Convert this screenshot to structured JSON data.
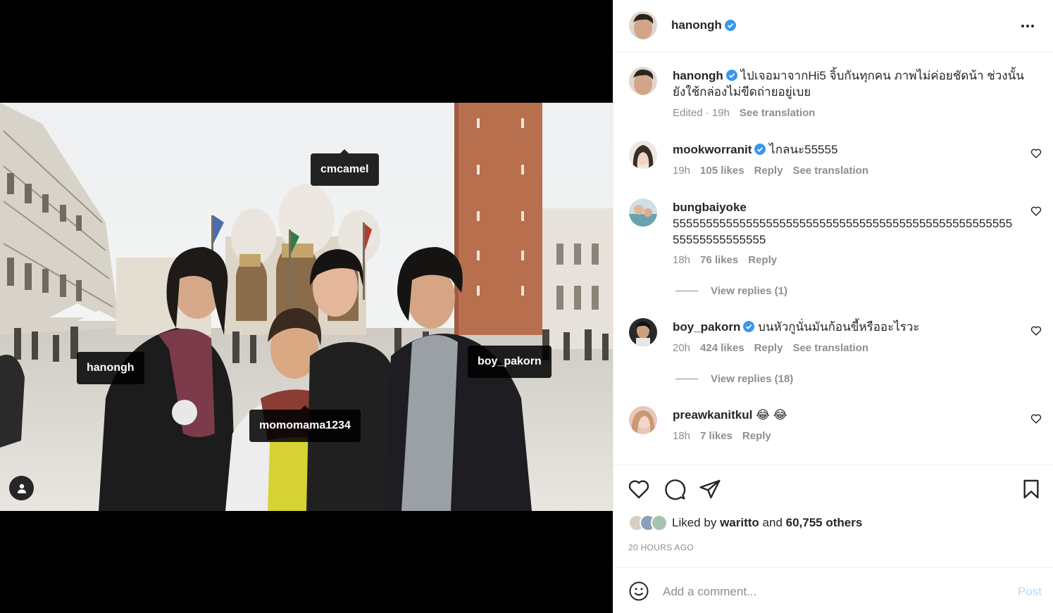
{
  "post": {
    "author": "hanongh",
    "verified_icon": "verified-badge-icon",
    "photo_tags": [
      "cmcamel",
      "hanongh",
      "boy_pakorn",
      "momomama1234"
    ],
    "caption": {
      "author": "hanongh",
      "text": "ไปเจอมาจากHi5 จิ้บกันทุกคน ภาพไม่ค่อยชัดน้า ช่วงนั้นยังใช้กล่องไม่ขีดถ่ายอยู่เบย",
      "meta": "Edited · 19h",
      "see_translation": "See translation"
    }
  },
  "comments": [
    {
      "user": "mookworranit",
      "verified": true,
      "text": "ไกลนะ55555",
      "time": "19h",
      "likes": "105 likes",
      "reply": "Reply",
      "translation": "See translation"
    },
    {
      "user": "bungbaiyoke",
      "verified": false,
      "text": "55555555555555555555555555555555555555555555555555555555555555555",
      "time": "18h",
      "likes": "76 likes",
      "reply": "Reply",
      "view_replies": "View replies (1)"
    },
    {
      "user": "boy_pakorn",
      "verified": true,
      "text": "บนหัวกูนั่นมันก้อนขี้หรืออะไรวะ",
      "time": "20h",
      "likes": "424 likes",
      "reply": "Reply",
      "translation": "See translation",
      "view_replies": "View replies (18)"
    },
    {
      "user": "preawkanitkul",
      "verified": false,
      "text": "😂 😂",
      "time": "18h",
      "likes": "7 likes",
      "reply": "Reply"
    }
  ],
  "actions": {
    "liked_prefix": "Liked by",
    "liked_user": "waritto",
    "liked_and": "and",
    "liked_others": "60,755 others",
    "time_ago": "20 HOURS AGO"
  },
  "comment_box": {
    "placeholder": "Add a comment...",
    "post_label": "Post"
  },
  "colors": {
    "verified": "#3897f0",
    "link_disabled": "#b3dbff",
    "secondary_text": "#8e8e8e"
  }
}
